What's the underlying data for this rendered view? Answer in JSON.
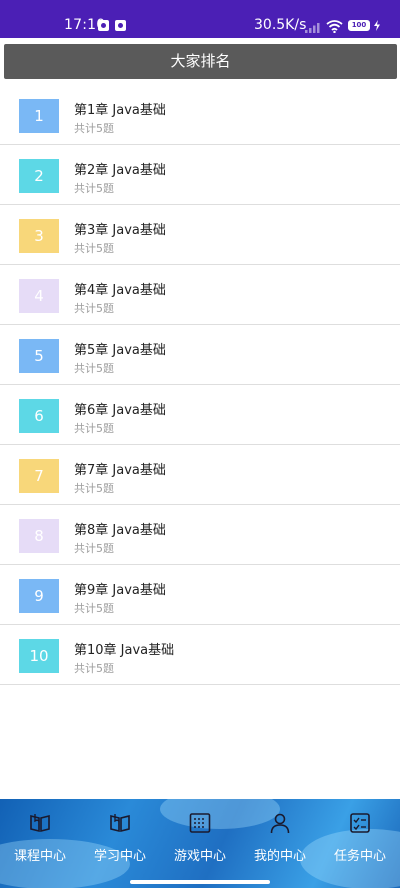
{
  "status_bar": {
    "time": "17:10",
    "network_speed": "30.5K/s",
    "battery": "100"
  },
  "header": {
    "title": "大家排名"
  },
  "chapters": [
    {
      "number": "1",
      "title": "第1章 Java基础",
      "subtitle": "共计5题",
      "color": "#7ab8f5"
    },
    {
      "number": "2",
      "title": "第2章 Java基础",
      "subtitle": "共计5题",
      "color": "#5dd8e6"
    },
    {
      "number": "3",
      "title": "第3章 Java基础",
      "subtitle": "共计5题",
      "color": "#f8d77a"
    },
    {
      "number": "4",
      "title": "第4章 Java基础",
      "subtitle": "共计5题",
      "color": "#e6dcf7"
    },
    {
      "number": "5",
      "title": "第5章 Java基础",
      "subtitle": "共计5题",
      "color": "#7ab8f5"
    },
    {
      "number": "6",
      "title": "第6章 Java基础",
      "subtitle": "共计5题",
      "color": "#5dd8e6"
    },
    {
      "number": "7",
      "title": "第7章 Java基础",
      "subtitle": "共计5题",
      "color": "#f8d77a"
    },
    {
      "number": "8",
      "title": "第8章 Java基础",
      "subtitle": "共计5题",
      "color": "#e6dcf7"
    },
    {
      "number": "9",
      "title": "第9章 Java基础",
      "subtitle": "共计5题",
      "color": "#7ab8f5"
    },
    {
      "number": "10",
      "title": "第10章 Java基础",
      "subtitle": "共计5题",
      "color": "#5dd8e6"
    }
  ],
  "bottom_nav": {
    "tabs": [
      {
        "label": "课程中心",
        "icon": "book-icon"
      },
      {
        "label": "学习中心",
        "icon": "book-icon"
      },
      {
        "label": "游戏中心",
        "icon": "grid-icon"
      },
      {
        "label": "我的中心",
        "icon": "person-icon"
      },
      {
        "label": "任务中心",
        "icon": "checklist-icon"
      }
    ]
  },
  "colors": {
    "status_bar": "#4b1fb5",
    "header": "#5a5a5a",
    "nav_background": "#1f6fc2"
  }
}
